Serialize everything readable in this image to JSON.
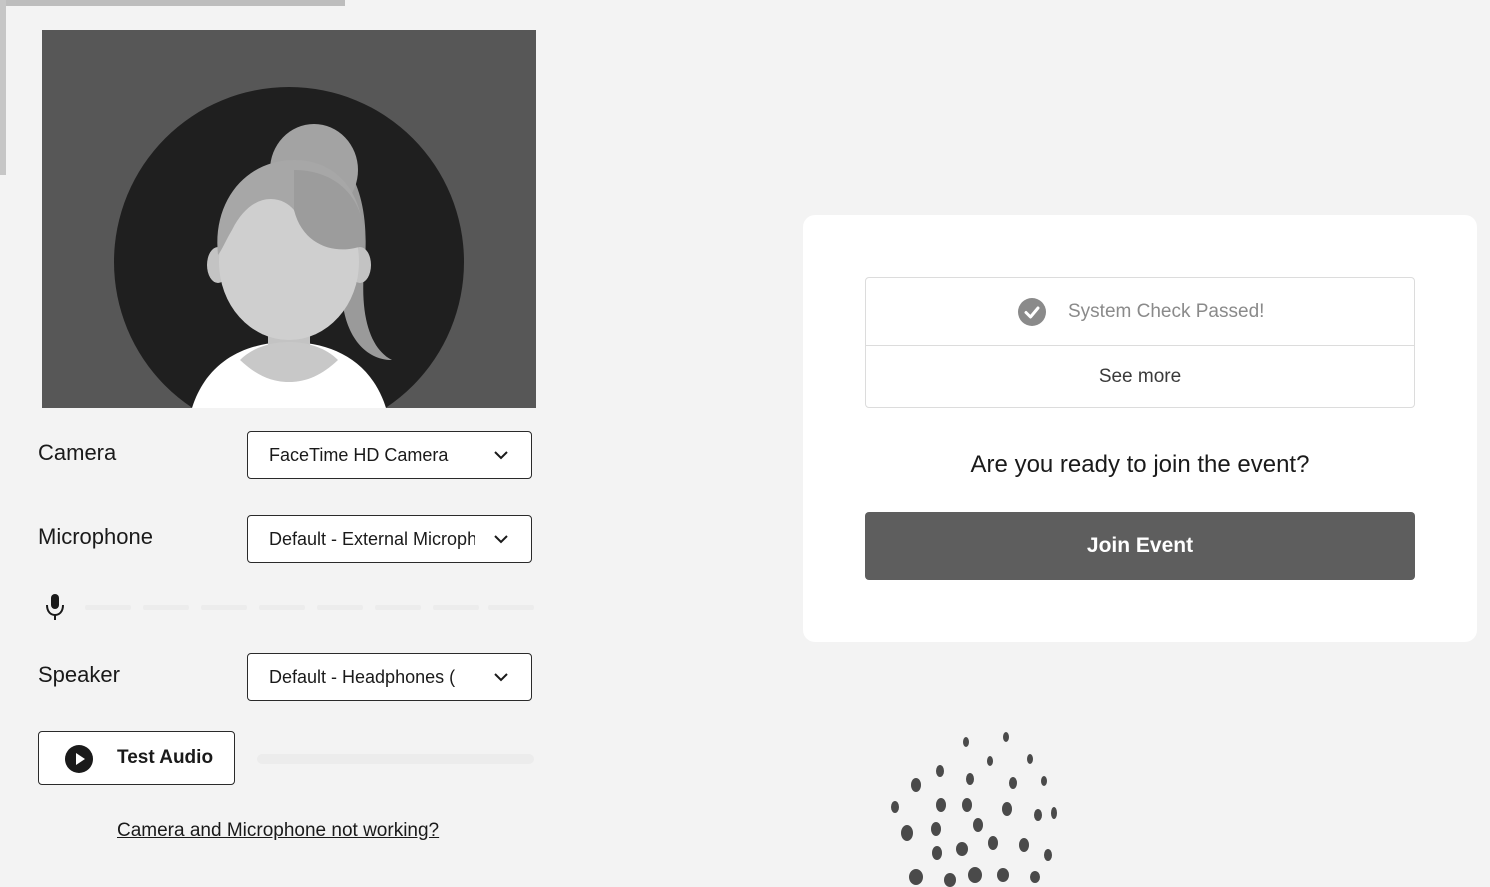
{
  "preview": {
    "avatar": "user-avatar-placeholder"
  },
  "devices": {
    "camera": {
      "label": "Camera",
      "value": "FaceTime HD Camera"
    },
    "microphone": {
      "label": "Microphone",
      "value": "Default - External Microphone"
    },
    "speaker": {
      "label": "Speaker",
      "value": "Default - Headphones ("
    }
  },
  "mic_level": {
    "icon": "microphone-icon",
    "level": 0
  },
  "test_audio": {
    "label": "Test Audio",
    "icon": "play-icon",
    "progress": 0
  },
  "trouble_link": "Camera and Microphone not working?",
  "system_check": {
    "status": "System Check Passed!",
    "icon": "check-circle-icon",
    "see_more": "See more"
  },
  "join": {
    "question": "Are you ready to join the event?",
    "button_label": "Join Event"
  },
  "colors": {
    "join_button": "#5e5e5e",
    "preview_bg": "#575757",
    "avatar_circle": "#1f1f1f",
    "status_text": "#8a8a8a"
  }
}
